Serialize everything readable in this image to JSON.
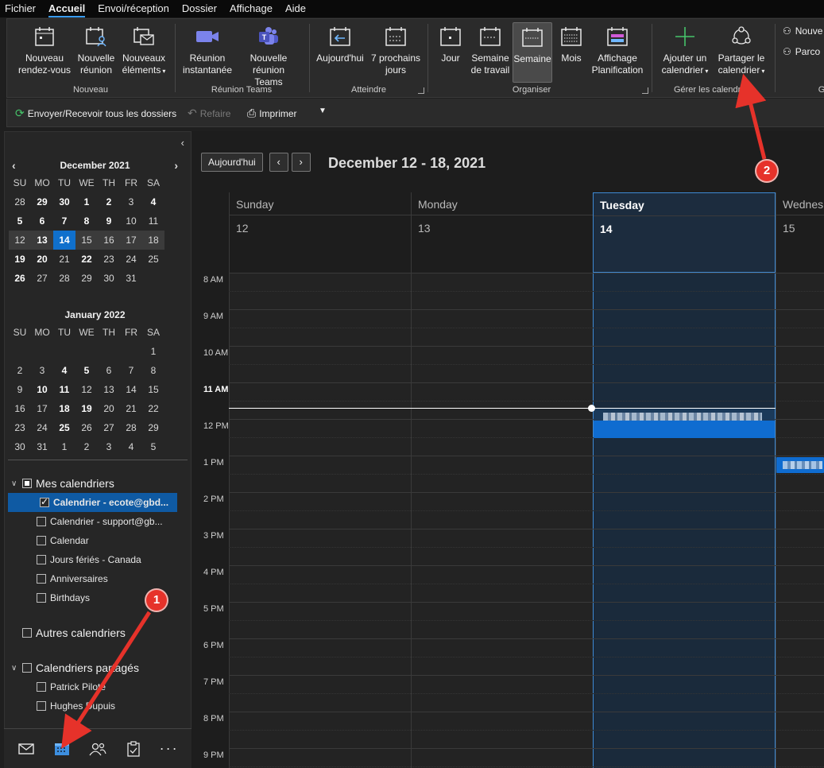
{
  "menu": {
    "items": [
      "Fichier",
      "Accueil",
      "Envoi/réception",
      "Dossier",
      "Affichage",
      "Aide"
    ],
    "active": "Accueil"
  },
  "ribbon": {
    "new_appointment": [
      "Nouveau",
      "rendez-vous"
    ],
    "new_meeting": [
      "Nouvelle",
      "réunion"
    ],
    "new_items": [
      "Nouveaux",
      "éléments"
    ],
    "group_new": "Nouveau",
    "instant_meeting": [
      "Réunion",
      "instantanée"
    ],
    "new_teams_meeting": [
      "Nouvelle",
      "réunion Teams"
    ],
    "group_teams": "Réunion Teams",
    "today": "Aujourd'hui",
    "next7": [
      "7 prochains",
      "jours"
    ],
    "group_goto": "Atteindre",
    "day": "Jour",
    "workweek": [
      "Semaine",
      "de travail"
    ],
    "week": "Semaine",
    "month": "Mois",
    "schedule": [
      "Affichage",
      "Planification"
    ],
    "group_arrange": "Organiser",
    "add_calendar": [
      "Ajouter un",
      "calendrier"
    ],
    "share_calendar": [
      "Partager le",
      "calendrier"
    ],
    "group_manage": "Gérer les calendriers",
    "side_new": "Nouve",
    "side_browse": "Parco",
    "group_side": "G"
  },
  "qat": {
    "send_receive": "Envoyer/Recevoir tous les dossiers",
    "redo": "Refaire",
    "print": "Imprimer"
  },
  "minical": {
    "dec": {
      "title": "December 2021",
      "weekdays": [
        "SU",
        "MO",
        "TU",
        "WE",
        "TH",
        "FR",
        "SA"
      ],
      "days": [
        "28",
        "29",
        "30",
        "1",
        "2",
        "3",
        "4",
        "5",
        "6",
        "7",
        "8",
        "9",
        "10",
        "11",
        "12",
        "13",
        "14",
        "15",
        "16",
        "17",
        "18",
        "19",
        "20",
        "21",
        "22",
        "23",
        "24",
        "25",
        "26",
        "27",
        "28",
        "29",
        "30",
        "31"
      ]
    },
    "jan": {
      "title": "January 2022",
      "weekdays": [
        "SU",
        "MO",
        "TU",
        "WE",
        "TH",
        "FR",
        "SA"
      ],
      "days": [
        "1",
        "2",
        "3",
        "4",
        "5",
        "6",
        "7",
        "8",
        "9",
        "10",
        "11",
        "12",
        "13",
        "14",
        "15",
        "16",
        "17",
        "18",
        "19",
        "20",
        "21",
        "22",
        "23",
        "24",
        "25",
        "26",
        "27",
        "28",
        "29",
        "30",
        "31",
        "1",
        "2",
        "3",
        "4",
        "5"
      ]
    }
  },
  "calendars": {
    "my_title": "Mes calendriers",
    "my": [
      "Calendrier - ecote@gbd...",
      "Calendrier - support@gb...",
      "Calendar",
      "Jours fériés - Canada",
      "Anniversaires",
      "Birthdays"
    ],
    "other_title": "Autres calendriers",
    "shared_title": "Calendriers partagés",
    "shared": [
      "Patrick Pilote",
      "Hughes Dupuis"
    ]
  },
  "view": {
    "today_button": "Aujourd'hui",
    "range_title": "December 12 - 18, 2021",
    "days": [
      {
        "name": "Sunday",
        "date": "12"
      },
      {
        "name": "Monday",
        "date": "13"
      },
      {
        "name": "Tuesday",
        "date": "14"
      },
      {
        "name": "Wednes",
        "date": "15"
      }
    ],
    "hours": [
      "8 AM",
      "9 AM",
      "10 AM",
      "11 AM",
      "12 PM",
      "1 PM",
      "2 PM",
      "3 PM",
      "4 PM",
      "5 PM",
      "6 PM",
      "7 PM",
      "8 PM",
      "9 PM"
    ],
    "current_hour": "11 AM"
  },
  "annotations": {
    "badge1": "1",
    "badge2": "2",
    "color": "#e6322a"
  }
}
